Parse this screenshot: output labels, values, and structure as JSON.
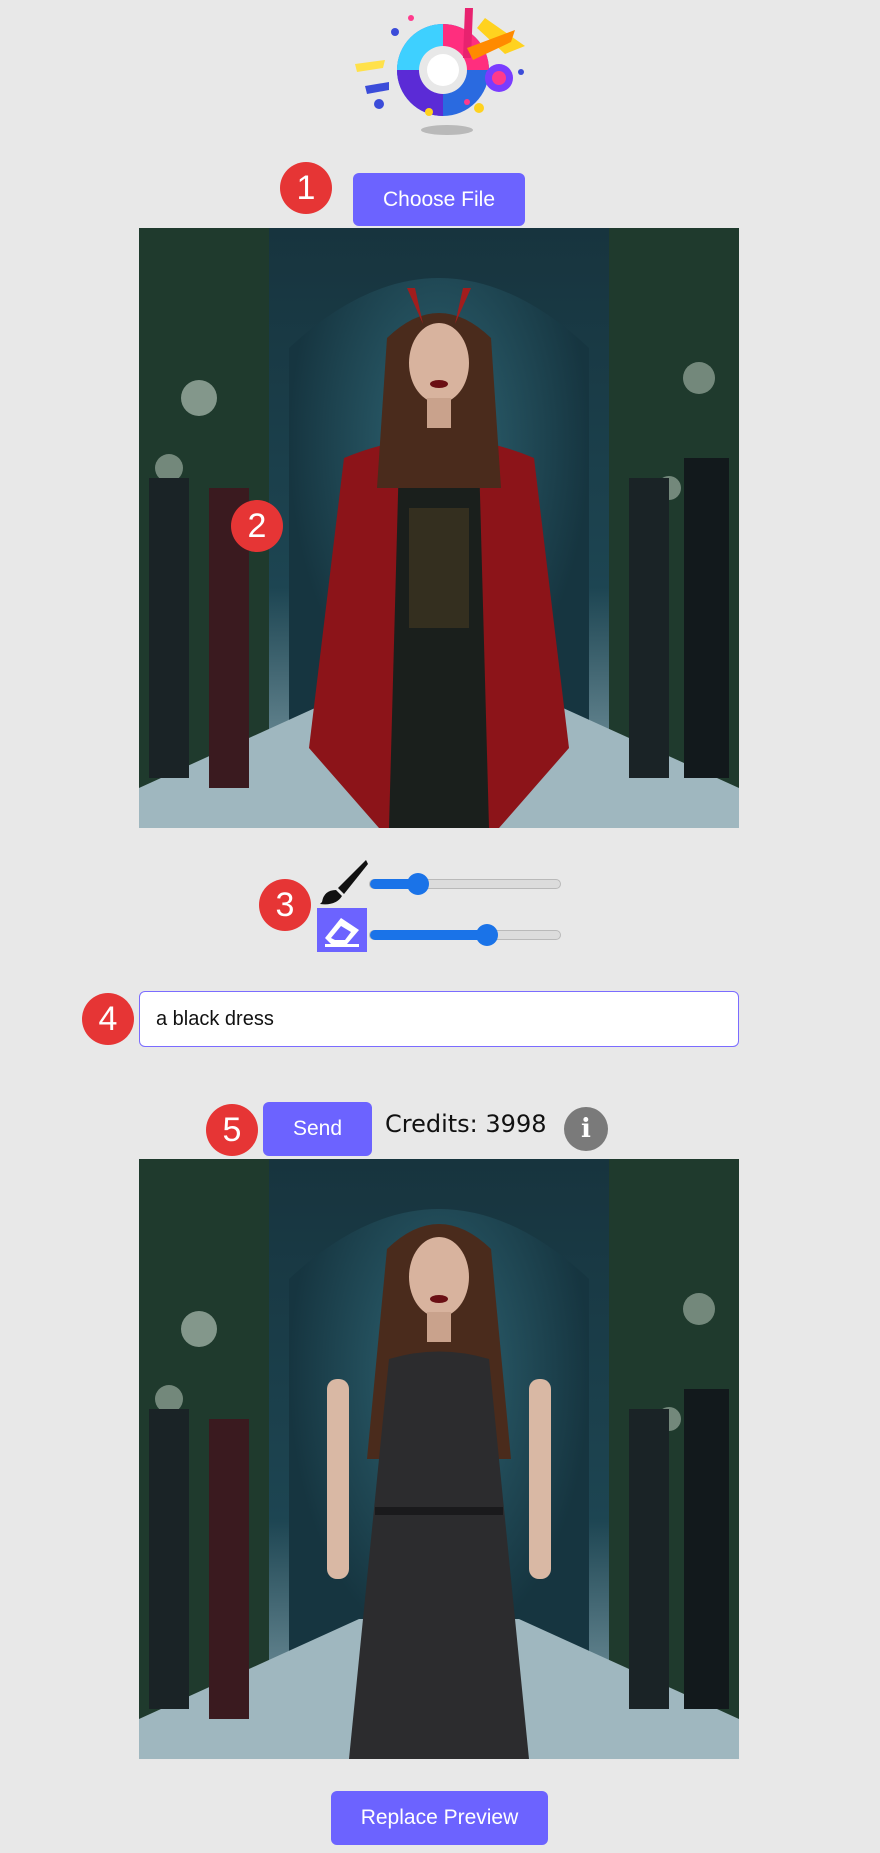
{
  "steps": {
    "step1": "1",
    "step2": "2",
    "step3": "3",
    "step4": "4",
    "step5": "5"
  },
  "upload": {
    "choose_file_label": "Choose File"
  },
  "brush": {
    "icon": "paintbrush-icon",
    "size_fraction": 0.25
  },
  "eraser": {
    "icon": "eraser-icon",
    "selected": true,
    "size_fraction": 0.61
  },
  "prompt": {
    "value": "a black dress"
  },
  "actions": {
    "send_label": "Send",
    "credits_label": "Credits:",
    "credits_value": "3998",
    "info_icon": "info-icon",
    "info_glyph": "i",
    "replace_preview_label": "Replace Preview"
  },
  "colors": {
    "accent": "#6c63ff",
    "badge": "#e63535",
    "slider": "#1a73e8",
    "background": "#e8e8e8"
  }
}
